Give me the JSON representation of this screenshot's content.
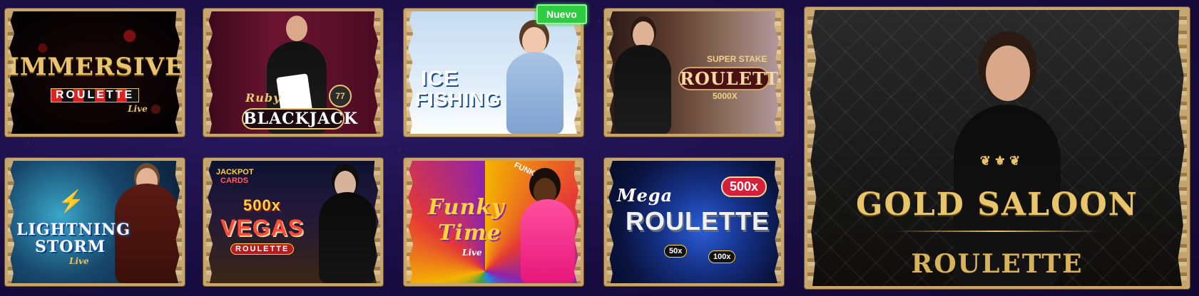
{
  "badges": {
    "new": "Nuevo"
  },
  "games": {
    "immersive": {
      "title": "IMMERSIVE",
      "sub": "ROULETTE",
      "tag": "Live"
    },
    "blackjack": {
      "tag": "Ruby",
      "title": "BLACKJACK",
      "chip": "77"
    },
    "ice": {
      "line1": "ICE",
      "line2": "FISHING"
    },
    "superstake": {
      "top": "SUPER STAKE",
      "title": "ROULETTE",
      "mult": "5000X"
    },
    "lightning": {
      "line1": "LIGHTNING",
      "line2": "STORM",
      "tag": "Live"
    },
    "vegas": {
      "jackpot1": "JACKPOT",
      "jackpot2": "CARDS",
      "mult": "500x",
      "title": "VEGAS",
      "sub": "ROULETTE"
    },
    "funky": {
      "line1": "Funky",
      "line2": "Time",
      "tag": "Live",
      "wheel": "FUNK"
    },
    "mega": {
      "mega": "Mega",
      "title": "ROULETTE",
      "badge": "500x",
      "m1": "50x",
      "m2": "100x"
    },
    "gold": {
      "title": "GOLD SALOON",
      "sub": "ROULETTE"
    }
  },
  "colors": {
    "frame": "#c9a56a",
    "gold": "#e8c46a",
    "new_badge": "#2ecc40"
  }
}
